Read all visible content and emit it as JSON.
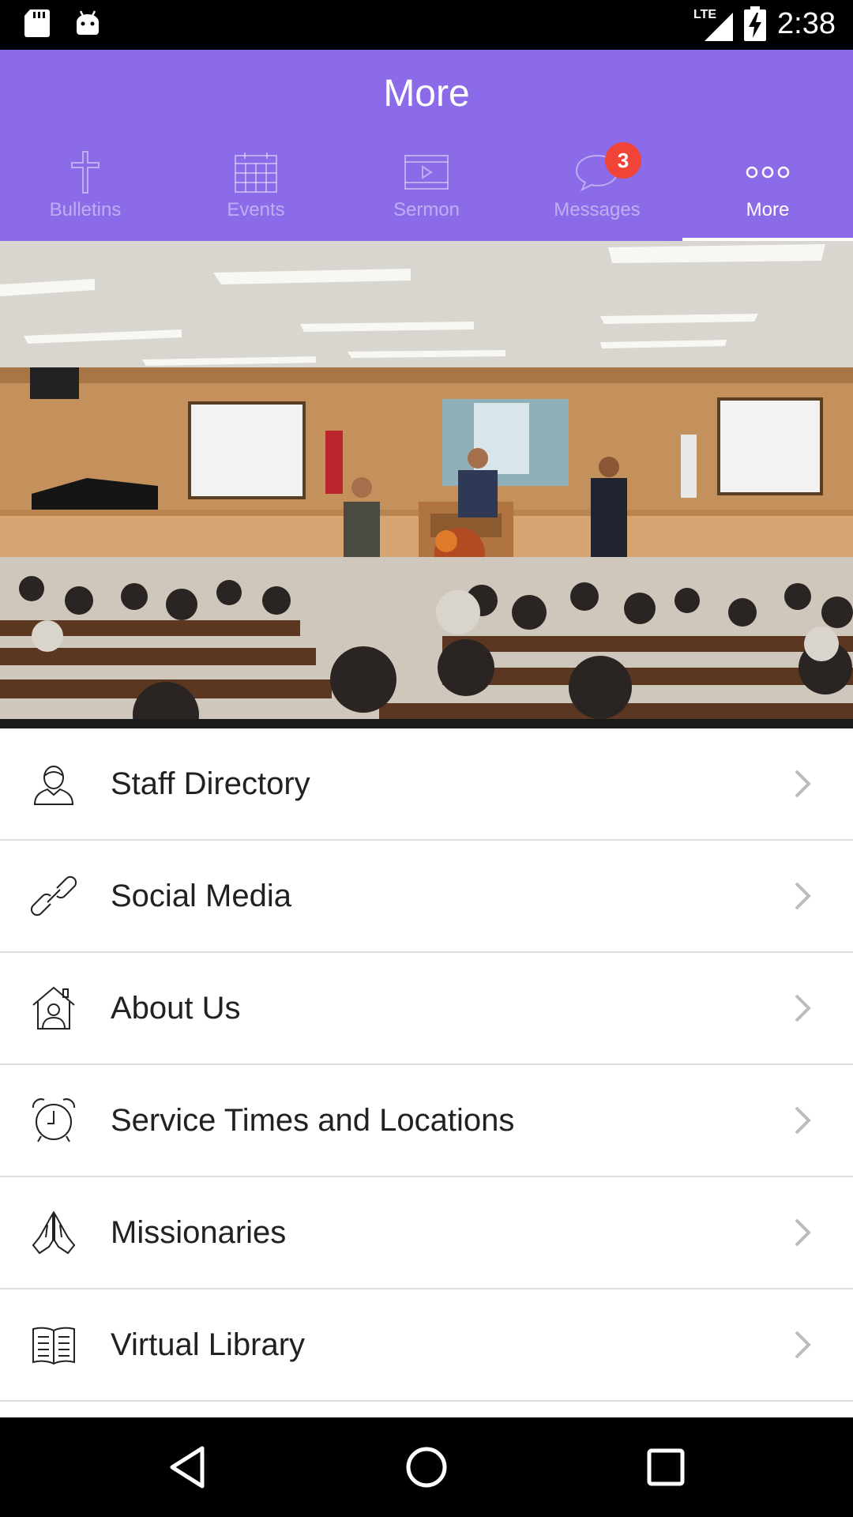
{
  "status_bar": {
    "network": "LTE",
    "time": "2:38",
    "icons": [
      "sd-card-icon",
      "android-icon",
      "signal-icon",
      "battery-charging-icon"
    ]
  },
  "header": {
    "title": "More"
  },
  "tabs": [
    {
      "label": "Bulletins",
      "icon": "cross-icon",
      "active": false
    },
    {
      "label": "Events",
      "icon": "calendar-icon",
      "active": false
    },
    {
      "label": "Sermon",
      "icon": "video-icon",
      "active": false
    },
    {
      "label": "Messages",
      "icon": "chat-bubble-icon",
      "active": false,
      "badge": "3"
    },
    {
      "label": "More",
      "icon": "more-dots-icon",
      "active": true
    }
  ],
  "hero": {
    "description_icon": "church-photo"
  },
  "menu": {
    "items": [
      {
        "label": "Staff Directory",
        "icon": "person-icon"
      },
      {
        "label": "Social Media",
        "icon": "link-icon"
      },
      {
        "label": "About Us",
        "icon": "house-person-icon"
      },
      {
        "label": "Service Times and Locations",
        "icon": "alarm-clock-icon"
      },
      {
        "label": "Missionaries",
        "icon": "praying-hands-icon"
      },
      {
        "label": "Virtual Library",
        "icon": "open-book-icon"
      }
    ]
  },
  "colors": {
    "header": "#8b6be8",
    "badge": "#f04438",
    "divider": "#dcdcdc"
  }
}
